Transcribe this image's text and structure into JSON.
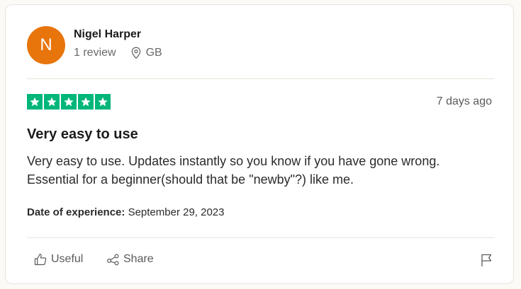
{
  "reviewer": {
    "initial": "N",
    "name": "Nigel Harper",
    "review_count": "1 review",
    "country": "GB",
    "avatar_color": "#e8740c"
  },
  "review": {
    "rating": 5,
    "star_color": "#00b67a",
    "date_ago": "7 days ago",
    "title": "Very easy to use",
    "body": "Very easy to use. Updates instantly so you know if you have gone wrong. Essential for a beginner(should that be \"newby\"?) like me.",
    "experience_label": "Date of experience:",
    "experience_date": "September 29, 2023"
  },
  "actions": {
    "useful_label": "Useful",
    "share_label": "Share"
  }
}
